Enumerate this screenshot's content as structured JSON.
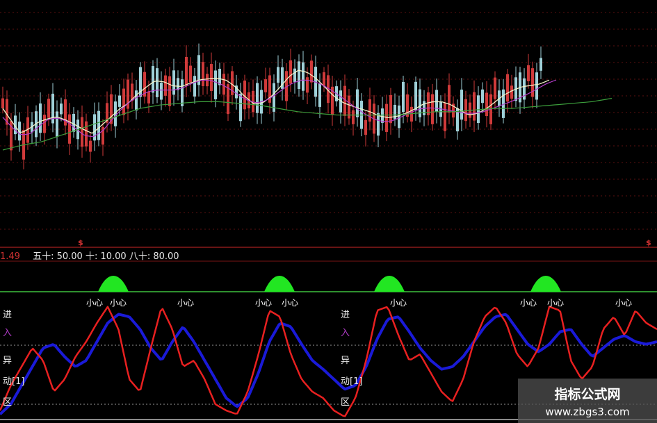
{
  "header": {
    "value_left": "1.49",
    "param_text": "五十: 50.00  十: 10.00  八十: 80.00"
  },
  "side_labels": [
    "进",
    "入",
    "异",
    "动[1]",
    "区"
  ],
  "caution_label": "小心",
  "top_markers": [
    "$",
    "$"
  ],
  "watermark": {
    "title": "指标公式网",
    "url": "www.zbgs3.com"
  },
  "colors": {
    "background": "#000000",
    "up_candle": "#cf3a3a",
    "down_candle": "#9fd0d8",
    "ma_short": "#f2f2c8",
    "ma_mid": "#b23cc8",
    "ma_long": "#3c9e3c",
    "osc_red": "#e82020",
    "osc_blue": "#1a1ad8",
    "peak_fill": "#22e622",
    "level_line": "#3fbf3f",
    "grid": "#7a1414"
  },
  "chart_data": [
    {
      "type": "candlestick",
      "title": "",
      "series": [
        {
          "name": "",
          "values": [
            60,
            50,
            42,
            46,
            52,
            56,
            58,
            55,
            50,
            45,
            42,
            48,
            55,
            62,
            66,
            70,
            72,
            74,
            73,
            72,
            74,
            78,
            80,
            79,
            77,
            74,
            70,
            66,
            64,
            66,
            70,
            74,
            78,
            80,
            79,
            77,
            74,
            70,
            66,
            62,
            58,
            55,
            53,
            54,
            57,
            60,
            62,
            63,
            62,
            61,
            60,
            59,
            58,
            60,
            62,
            64,
            66,
            68,
            71,
            74,
            77,
            80
          ]
        },
        {
          "name": "",
          "values": [
            35,
            38,
            40,
            44,
            48,
            52,
            56,
            60,
            62,
            63,
            64,
            64,
            63,
            62,
            60,
            58,
            57,
            56,
            56,
            56,
            56,
            57,
            58,
            58,
            59,
            60,
            60,
            61,
            62,
            63,
            64,
            66
          ]
        }
      ]
    },
    {
      "type": "line",
      "title": "",
      "ylim": [
        0,
        100
      ],
      "reference_lines": [
        80,
        50,
        10
      ],
      "series": [
        {
          "name": "",
          "values": [
            5,
            25,
            40,
            55,
            45,
            20,
            30,
            48,
            60,
            75,
            88,
            70,
            30,
            20,
            55,
            88,
            70,
            40,
            45,
            30,
            10,
            5,
            2,
            20,
            50,
            85,
            80,
            50,
            30,
            20,
            15,
            5,
            0,
            15,
            45,
            85,
            88,
            65,
            45,
            50,
            35,
            20,
            12,
            30,
            60,
            80,
            88,
            75,
            50,
            40,
            55,
            88,
            85,
            45,
            30,
            40,
            70,
            80,
            65,
            85,
            75,
            70
          ]
        },
        {
          "name": "",
          "values": [
            2,
            10,
            25,
            40,
            55,
            58,
            48,
            40,
            45,
            60,
            75,
            82,
            80,
            70,
            55,
            45,
            60,
            72,
            60,
            45,
            30,
            15,
            8,
            15,
            35,
            60,
            75,
            72,
            58,
            45,
            38,
            30,
            22,
            25,
            40,
            62,
            78,
            80,
            68,
            55,
            45,
            38,
            40,
            48,
            60,
            72,
            80,
            82,
            70,
            58,
            52,
            58,
            68,
            70,
            58,
            48,
            55,
            62,
            65,
            60,
            58,
            60
          ]
        }
      ]
    }
  ]
}
